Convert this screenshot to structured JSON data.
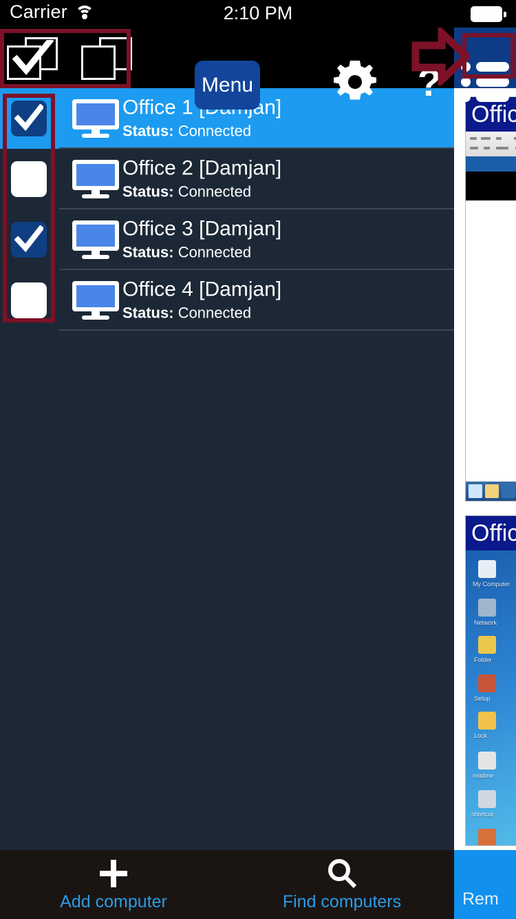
{
  "status_bar": {
    "carrier": "Carrier",
    "wifi_icon": "wifi-icon",
    "time": "2:10 PM",
    "battery_icon": "battery-full-icon"
  },
  "toolbar": {
    "select_all_icon": "select-all-checked-icon",
    "deselect_all_icon": "deselect-all-icon",
    "menu_label": "Menu",
    "settings_icon": "gear-icon",
    "help_label": "?",
    "help_icon": "question-mark-icon",
    "list_view_icon": "list-view-icon"
  },
  "annotations": {
    "color": "#7d1127",
    "select_icons_box": "highlight-select-toggle-icons",
    "list_button_box": "highlight-list-view-button",
    "checkbox_column_box": "highlight-row-checkboxes",
    "arrow": "red-arrow-pointing-right"
  },
  "computers": {
    "status_label": "Status:",
    "rows": [
      {
        "name": "Office 1 [Damjan]",
        "status": "Connected",
        "checked": true,
        "selected": true
      },
      {
        "name": "Office 2 [Damjan]",
        "status": "Connected",
        "checked": false,
        "selected": false
      },
      {
        "name": "Office 3 [Damjan]",
        "status": "Connected",
        "checked": true,
        "selected": false
      },
      {
        "name": "Office 4 [Damjan]",
        "status": "Connected",
        "checked": false,
        "selected": false
      }
    ]
  },
  "thumbnails": [
    {
      "title": "Office",
      "kind": "remote-desktop-document-window"
    },
    {
      "title": "Office",
      "kind": "remote-desktop-windows-xp"
    }
  ],
  "bottom_bar": {
    "add_label": "Add computer",
    "add_icon": "plus-icon",
    "find_label": "Find computers",
    "find_icon": "search-icon",
    "remote_label": "Rem"
  },
  "colors": {
    "accent_blue": "#1c9bf0",
    "panel_dark": "#1c2836",
    "menu_blue": "#12459b",
    "annotation_red": "#7d1127",
    "bottom_bar": "#1a1512"
  }
}
